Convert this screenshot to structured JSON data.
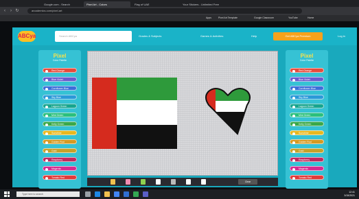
{
  "browser": {
    "tabs": [
      {
        "label": "Google.com - Search"
      },
      {
        "label": "Pixel Art - Colors"
      },
      {
        "label": "Flag of UAE"
      },
      {
        "label": "Your Stickers - Unlimited Free"
      }
    ],
    "url": "arcademics.com/pixel-art",
    "bookmarks": [
      "Apps",
      "Pixel Art Template",
      "Google Classroom",
      "YouTube",
      "Home"
    ]
  },
  "header": {
    "logo_text": "ABCya",
    "search_placeholder": "Search ABCya",
    "nav": [
      "Grades & Subjects",
      "Games & Activities",
      "Help"
    ],
    "cta_label": "Get ABCya Premium",
    "login_label": "Log in"
  },
  "palettes": {
    "title_big": "Pixel",
    "title_small": "Color Palette",
    "colors": [
      {
        "name": "Red Orange",
        "hex": "#e74a3b"
      },
      {
        "name": "Blue Violet",
        "hex": "#6a5acd"
      },
      {
        "name": "Cornflower Blue",
        "hex": "#3b6fd8"
      },
      {
        "name": "Sky Blue",
        "hex": "#2b9ad8"
      },
      {
        "name": "Lagoon Green",
        "hex": "#17a58f"
      },
      {
        "name": "Mint Green",
        "hex": "#2bbf7e"
      },
      {
        "name": "Kelly Green",
        "hex": "#3aa84a"
      },
      {
        "name": "Sunshine",
        "hex": "#e8b820"
      },
      {
        "name": "Golden Rod",
        "hex": "#d49a22"
      },
      {
        "name": "Gold",
        "hex": "#c8a028"
      },
      {
        "name": "Raspberry",
        "hex": "#c0285e"
      },
      {
        "name": "Magenta",
        "hex": "#d42a8f"
      },
      {
        "name": "Tomato Red",
        "hex": "#e13b3b"
      }
    ]
  },
  "canvas": {
    "flag_colors": {
      "red": "#d52b1e",
      "green": "#2e9a3b",
      "white": "#ffffff",
      "black": "#111111"
    }
  },
  "toolbar": {
    "tools": [
      {
        "name": "pencil",
        "hex": "#f2c14e"
      },
      {
        "name": "eraser",
        "hex": "#f28cb1"
      },
      {
        "name": "fill",
        "hex": "#8fd14f"
      },
      {
        "name": "pen",
        "hex": "#ffffff"
      },
      {
        "name": "grid",
        "hex": "#bbbbbb"
      },
      {
        "name": "undo",
        "hex": "#ffffff"
      },
      {
        "name": "redo",
        "hex": "#ffffff"
      }
    ],
    "clear_label": "Clear"
  },
  "taskbar": {
    "search_placeholder": "Type here to search",
    "apps": [
      {
        "name": "task-view",
        "hex": "#9aa0a6"
      },
      {
        "name": "edge",
        "hex": "#1e88e5"
      },
      {
        "name": "file-explorer",
        "hex": "#f2c14e"
      },
      {
        "name": "store",
        "hex": "#4285f4"
      },
      {
        "name": "mail",
        "hex": "#2f6fd1"
      },
      {
        "name": "chrome",
        "hex": "#34a853"
      },
      {
        "name": "teams",
        "hex": "#5b5fc7"
      }
    ],
    "time": "12:41",
    "date": "3/15/2021"
  }
}
